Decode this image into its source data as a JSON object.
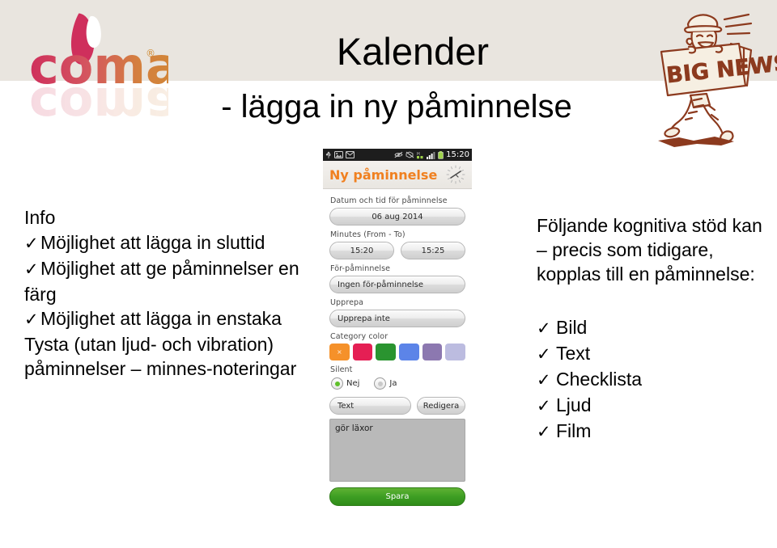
{
  "slide": {
    "title": "Kalender",
    "subtitle": "- lägga in ny påminnelse"
  },
  "logo": {
    "wordmark": "comai",
    "registered": "®"
  },
  "bignews": {
    "sign_text": "BIG NEWS"
  },
  "left_column": {
    "heading": "Info",
    "items": [
      "Möjlighet att lägga in sluttid",
      "Möjlighet att ge påminnelser en färg",
      "Möjlighet att lägga in enstaka Tysta (utan ljud- och vibration) påminnelser – minnes-noteringar"
    ],
    "tick": "✓"
  },
  "right_column": {
    "paragraph": "Följande kognitiva stöd kan – precis som tidigare, kopplas till en påminnelse:",
    "items": [
      "Bild",
      "Text",
      "Checklista",
      "Ljud",
      "Film"
    ],
    "tick": "✓"
  },
  "phone": {
    "statusbar": {
      "clock": "15:20",
      "left_icons": [
        "usb-icon",
        "image-icon",
        "mail-icon"
      ],
      "right_icons": [
        "silent-icon",
        "sync-off-icon",
        "hsdpa-icon",
        "signal-icon",
        "battery-icon"
      ]
    },
    "app_title": "Ny påminnelse",
    "header_icon": "clock-icon",
    "fields": {
      "datetime_label": "Datum och tid för påminnelse",
      "date_value": "06 aug 2014",
      "minutes_label": "Minutes (From - To)",
      "time_from": "15:20",
      "time_to": "15:25",
      "pre_reminder_label": "För-påminnelse",
      "pre_reminder_value": "Ingen för-påminnelse",
      "repeat_label": "Upprepa",
      "repeat_value": "Upprepa inte",
      "category_color_label": "Category color",
      "silent_label": "Silent",
      "silent_no": "Nej",
      "silent_yes": "Ja",
      "text_button": "Text",
      "edit_button": "Redigera",
      "note_value": "gör läxor",
      "save_button": "Spara"
    },
    "category_colors": [
      {
        "hex": "#f5912a",
        "selected": true
      },
      {
        "hex": "#e51f54",
        "selected": false
      },
      {
        "hex": "#2a9430",
        "selected": false
      },
      {
        "hex": "#5c84e8",
        "selected": false
      },
      {
        "hex": "#8c78b0",
        "selected": false
      },
      {
        "hex": "#bcbce0",
        "selected": false
      }
    ],
    "selected_marker": "×"
  },
  "colors": {
    "band": "#e9e5df",
    "app_accent": "#f08020",
    "save_green": "#3d9e23",
    "logo_pink": "#d0365f",
    "logo_orange": "#d2853a",
    "illustration_brown": "#8c3a1e"
  }
}
